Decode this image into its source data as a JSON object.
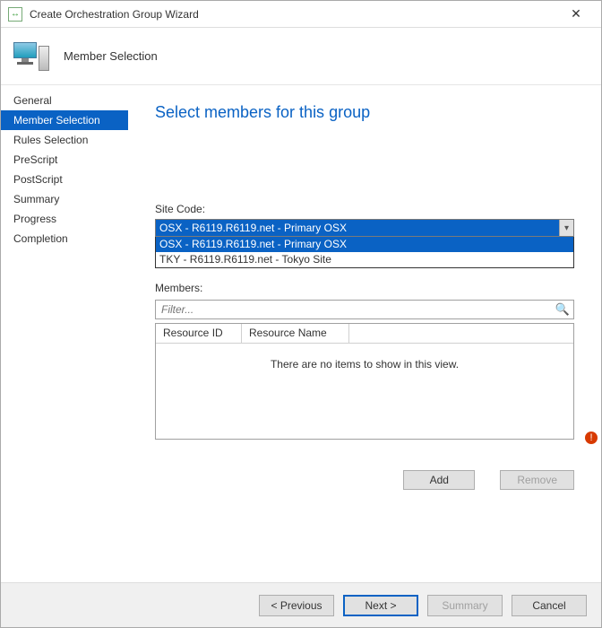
{
  "window": {
    "title": "Create Orchestration Group Wizard",
    "close_glyph": "✕"
  },
  "header": {
    "subtitle": "Member Selection"
  },
  "sidebar": {
    "steps": [
      {
        "label": "General",
        "selected": false
      },
      {
        "label": "Member Selection",
        "selected": true
      },
      {
        "label": "Rules Selection",
        "selected": false
      },
      {
        "label": "PreScript",
        "selected": false
      },
      {
        "label": "PostScript",
        "selected": false
      },
      {
        "label": "Summary",
        "selected": false
      },
      {
        "label": "Progress",
        "selected": false
      },
      {
        "label": "Completion",
        "selected": false
      }
    ]
  },
  "main": {
    "title": "Select members for this group",
    "site_code_label": "Site Code:",
    "site_code": {
      "selected": "OSX - R6119.R6119.net - Primary OSX",
      "options": [
        {
          "label": "OSX - R6119.R6119.net - Primary OSX",
          "selected": true
        },
        {
          "label": "TKY - R6119.R6119.net - Tokyo Site",
          "selected": false
        }
      ],
      "chevron": "▾"
    },
    "members_label": "Members:",
    "filter_placeholder": "Filter...",
    "search_glyph": "🔍",
    "table": {
      "columns": [
        "Resource ID",
        "Resource Name"
      ],
      "empty_text": "There are no items to show in this view.",
      "rows": []
    },
    "warn_glyph": "!",
    "buttons": {
      "add": "Add",
      "remove": "Remove"
    }
  },
  "footer": {
    "previous": "< Previous",
    "next": "Next >",
    "summary": "Summary",
    "cancel": "Cancel"
  }
}
